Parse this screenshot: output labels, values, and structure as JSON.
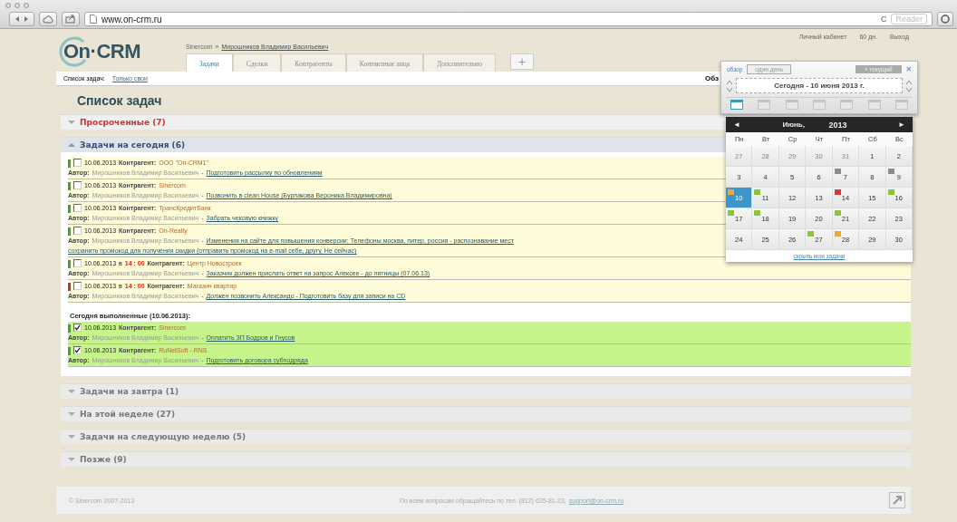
{
  "browser": {
    "url": "www.on-crm.ru",
    "reload": "C",
    "reader": "Reader"
  },
  "header": {
    "logo": "On·CRM",
    "breadcrumb": {
      "company": "Sinercom",
      "separator": "»",
      "user": "Мирошников Владимир Васильевич"
    },
    "tabs": [
      {
        "label": "Задачи",
        "selected": true
      },
      {
        "label": "Сделки",
        "selected": false
      },
      {
        "label": "Контрагенты",
        "selected": false
      },
      {
        "label": "Контактные лица",
        "selected": false
      },
      {
        "label": "Дополнительно",
        "selected": false
      }
    ],
    "add_tab": "+",
    "account": [
      "Личный кабинет",
      "60 дн.",
      "Выход"
    ]
  },
  "toolbar": {
    "label": "Список задач:",
    "filter": "Только свои",
    "right": "Обз"
  },
  "title": "Список задач",
  "groups": [
    {
      "label": "Просроченные (7)",
      "kind": "overdue",
      "expanded": false
    },
    {
      "label": "Задачи на сегодня (6)",
      "kind": "today",
      "expanded": true,
      "tasks": [
        {
          "checked": false,
          "color": "#3aa63a",
          "date": "10.06.2013",
          "contractor_label": "Контрагент:",
          "contractor": "ООО \"On-CRM1\"",
          "author_label": "Автор:",
          "author": "Мирошников Владимир Васильевич",
          "sep": "-",
          "links": [
            "Подготовить рассылку по обновлениям"
          ]
        },
        {
          "checked": false,
          "color": "#3aa63a",
          "date": "10.06.2013",
          "contractor_label": "Контрагент:",
          "contractor": "Sinercom",
          "author_label": "Автор:",
          "author": "Мирошников Владимир Васильевич",
          "sep": "-",
          "links": [
            "Позвонить в clean House (Бурлакова Вероника Владимировна)"
          ]
        },
        {
          "checked": false,
          "color": "#3aa63a",
          "date": "10.06.2013",
          "contractor_label": "Контрагент:",
          "contractor": "ТрансКредитБанк",
          "author_label": "Автор:",
          "author": "Мирошников Владимир Васильевич",
          "sep": "-",
          "links": [
            "Забрать чековую книжку"
          ]
        },
        {
          "checked": false,
          "color": "#3aa63a",
          "date": "10.06.2013",
          "contractor_label": "Контрагент:",
          "contractor": "On-Realty",
          "author_label": "Автор:",
          "author": "Мирошников Владимир Васильевич",
          "sep": "-",
          "links": [
            "Изменения на сайте для повышения конверсии: Телефоны москва, питер, россия - распознавание мест",
            "сохранить промокод для получения скидки (отправить промокод на e-mail себе, другу, Не сейчас)"
          ]
        },
        {
          "checked": false,
          "color": "#3aa63a",
          "date": "10.06.2013",
          "at": "в",
          "time": "14 : 00",
          "contractor_label": "Контрагент:",
          "contractor": "Центр Новостроек",
          "author_label": "Автор:",
          "author": "Мирошников Владимир Васильевич",
          "sep": "-",
          "links": [
            "Заказчик должен прислать ответ на запрос Алексее - до пятницы (07.06.13)"
          ]
        },
        {
          "checked": false,
          "color": "#c83228",
          "date": "10.06.2013",
          "at": "в",
          "time": "14 : 00",
          "contractor_label": "Контрагент:",
          "contractor": "Магазин квартир",
          "author_label": "Автор:",
          "author": "Мирошников Владимир Васильевич",
          "sep": "-",
          "links": [
            "Должен позвонить Александо - Подготовить базу для записи на CD"
          ]
        }
      ],
      "done_heading": "Сегодня выполненные (10.06.2013):",
      "done_tasks": [
        {
          "checked": true,
          "color": "#3aa63a",
          "date": "10.06.2013",
          "contractor_label": "Контрагент:",
          "contractor": "Sinercom",
          "author_label": "Автор:",
          "author": "Мирошников Владимир Васильевич",
          "sep": "-",
          "links": [
            "Оплатить ЗП Бодров и Гнусов"
          ]
        },
        {
          "checked": true,
          "color": "#3aa63a",
          "date": "10.06.2013",
          "contractor_label": "Контрагент:",
          "contractor": "RuNetSoft - RNS",
          "author_label": "Автор:",
          "author": "Мирошников Владимир Васильевич",
          "sep": "-",
          "links": [
            "Подготовить договора субподряда"
          ]
        }
      ]
    },
    {
      "label": "Задачи на завтра (1)",
      "kind": "later",
      "expanded": false
    },
    {
      "label": "На этой неделе (27)",
      "kind": "later",
      "expanded": false
    },
    {
      "label": "Задачи на следующую неделю (5)",
      "kind": "later",
      "expanded": false
    },
    {
      "label": "Позже (9)",
      "kind": "later",
      "expanded": false
    }
  ],
  "footer": {
    "copyright": "© Sinercom 2007-2013",
    "contact": "По всем вопросам обращайтесь по тел. (812) 635-81-23,",
    "email": "support@on-crm.ru"
  },
  "calendar": {
    "overview": "обзор",
    "mode": "один день",
    "current": "+ текущий",
    "close": "×",
    "date": "Сегодня - 10 июня 2013 г.",
    "mini_days": [
      {
        "selected": true
      },
      {
        "selected": false
      },
      {
        "selected": false
      },
      {
        "selected": false
      },
      {
        "selected": false
      },
      {
        "selected": false
      },
      {
        "selected": false
      }
    ],
    "prev": "◄",
    "month": "Июнь,",
    "year": "2013",
    "next": "►",
    "weekdays": [
      "Пн",
      "Вт",
      "Ср",
      "Чт",
      "Пт",
      "Сб",
      "Вс"
    ],
    "weeks": [
      [
        {
          "day": "27",
          "other_month": true
        },
        {
          "day": "28",
          "other_month": true
        },
        {
          "day": "29",
          "other_month": true
        },
        {
          "day": "30",
          "other_month": true
        },
        {
          "day": "31",
          "other_month": true
        },
        {
          "day": "1",
          "other_month": false
        },
        {
          "day": "2",
          "other_month": false
        }
      ],
      [
        {
          "day": "3",
          "other_month": false
        },
        {
          "day": "4",
          "other_month": false
        },
        {
          "day": "5",
          "other_month": false
        },
        {
          "day": "6",
          "other_month": false
        },
        {
          "day": "7",
          "other_month": false,
          "color": "#8c8c8c"
        },
        {
          "day": "8",
          "other_month": false
        },
        {
          "day": "9",
          "other_month": false,
          "color": "#8c8c8c"
        }
      ],
      [
        {
          "day": "10",
          "other_month": false,
          "selected": true,
          "color": "#f0a830"
        },
        {
          "day": "11",
          "other_month": false,
          "color": "#8cc43c"
        },
        {
          "day": "12",
          "other_month": false
        },
        {
          "day": "13",
          "other_month": false
        },
        {
          "day": "14",
          "other_month": false,
          "color": "#d83a3a"
        },
        {
          "day": "15",
          "other_month": false
        },
        {
          "day": "16",
          "other_month": false,
          "color": "#8cc43c"
        }
      ],
      [
        {
          "day": "17",
          "other_month": false,
          "color": "#8cc43c"
        },
        {
          "day": "18",
          "other_month": false,
          "color": "#8cc43c"
        },
        {
          "day": "19",
          "other_month": false
        },
        {
          "day": "20",
          "other_month": false
        },
        {
          "day": "21",
          "other_month": false,
          "color": "#8cc43c"
        },
        {
          "day": "22",
          "other_month": false
        },
        {
          "day": "23",
          "other_month": false
        }
      ],
      [
        {
          "day": "24",
          "other_month": false
        },
        {
          "day": "25",
          "other_month": false
        },
        {
          "day": "26",
          "other_month": false
        },
        {
          "day": "27",
          "other_month": false,
          "color": "#8cc43c"
        },
        {
          "day": "28",
          "other_month": false,
          "color": "#f0a830"
        },
        {
          "day": "29",
          "other_month": false
        },
        {
          "day": "30",
          "other_month": false
        }
      ]
    ],
    "hide_link": "скрыть мои задачи"
  }
}
